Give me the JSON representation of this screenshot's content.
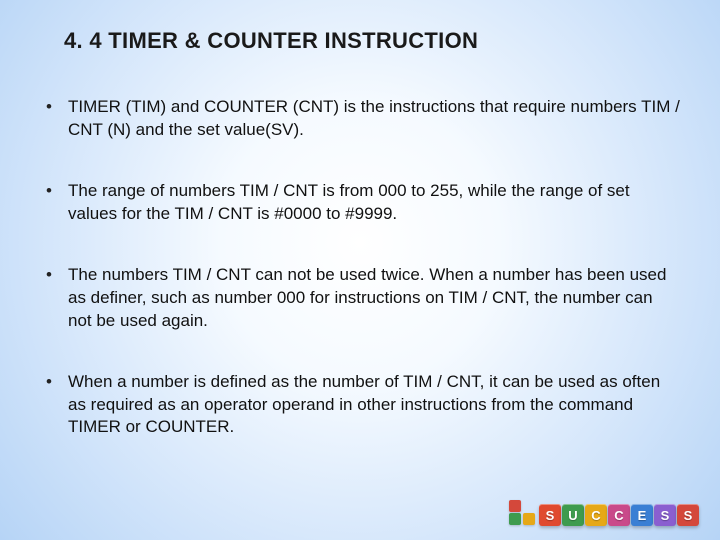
{
  "title": "4. 4 TIMER & COUNTER INSTRUCTION",
  "bullets": [
    "TIMER (TIM) and COUNTER (CNT) is the instructions that require numbers TIM / CNT (N) and the set value(SV).",
    "The range of numbers TIM / CNT is from 000 to 255, while the range of set values for the TIM / CNT is #0000 to #9999.",
    "The numbers TIM / CNT can not be used twice. When a number has been used as definer, such as number 000 for instructions on TIM / CNT, the number can not be used again.",
    "When a number is defined as the number of TIM / CNT, it can be used as often as required as an operator operand in other instructions from the command TIMER or COUNTER."
  ],
  "success": {
    "letters": [
      "S",
      "U",
      "C",
      "C",
      "E",
      "S",
      "S"
    ],
    "colors": [
      "#e04a2f",
      "#3e9b4e",
      "#e6a817",
      "#c94a8a",
      "#3a7fd4",
      "#8a5fd0",
      "#d4483b"
    ]
  }
}
